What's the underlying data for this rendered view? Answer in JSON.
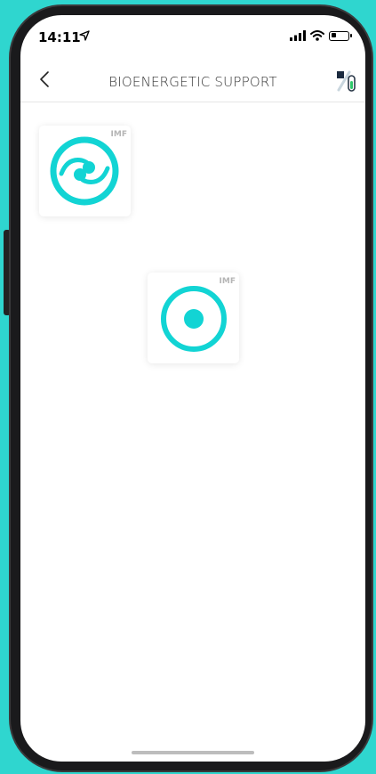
{
  "status_bar": {
    "time": "14:11",
    "icons": [
      "location-arrow-icon",
      "signal-icon",
      "wifi-icon",
      "battery-icon"
    ],
    "battery_level": 0.3
  },
  "nav": {
    "title": "BIOENERGETIC SUPPORT",
    "back_icon": "chevron-left-icon",
    "logo_icon": "app-logo-icon"
  },
  "cards": [
    {
      "badge": "IMF",
      "icon": "swirl-circle-icon"
    },
    {
      "badge": "IMF",
      "icon": "target-dot-icon"
    }
  ],
  "colors": {
    "accent": "#12d4d4",
    "background": "#2fd6cf",
    "badge": "#b5b5b5"
  }
}
